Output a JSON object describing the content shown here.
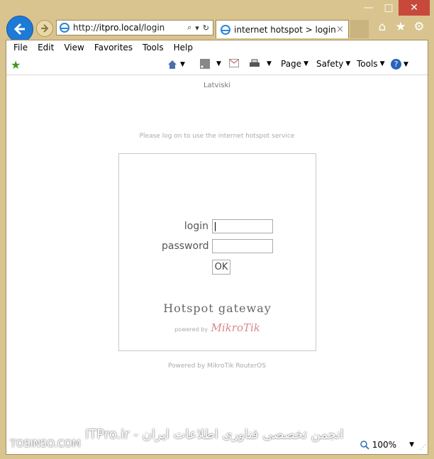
{
  "browser": {
    "address": {
      "url_prefix": "http://",
      "host": "itpro.local",
      "path": "/login",
      "search_symbol": "⌕",
      "drop_symbol": "▾",
      "refresh_symbol": "↻"
    },
    "tab": {
      "title": "internet hotspot > login",
      "close_symbol": "×"
    },
    "caption": {
      "minimize": "—",
      "maximize": "□",
      "close": "✕"
    },
    "right_icons": {
      "home": "⌂",
      "favorites": "★",
      "settings": "⚙"
    },
    "menus": [
      "File",
      "Edit",
      "View",
      "Favorites",
      "Tools",
      "Help"
    ],
    "commands": {
      "page": "Page",
      "safety": "Safety",
      "tools": "Tools",
      "help": "?"
    },
    "status": {
      "zoom": "100%"
    }
  },
  "page": {
    "language": "Latviski",
    "notice": "Please log on to use the internet hotspot service",
    "login_label": "login",
    "password_label": "password",
    "ok_label": "OK",
    "brand_title": "Hotspot gateway",
    "powered_by": "powered by",
    "brand_logo": "MikroTik",
    "footer": "Powered by MikroTik RouterOS"
  },
  "watermark": {
    "left": "TOSINSO.COM",
    "center": "ITPro.ir - انجمن تخصصی فناوری اطلاعات ایران"
  }
}
